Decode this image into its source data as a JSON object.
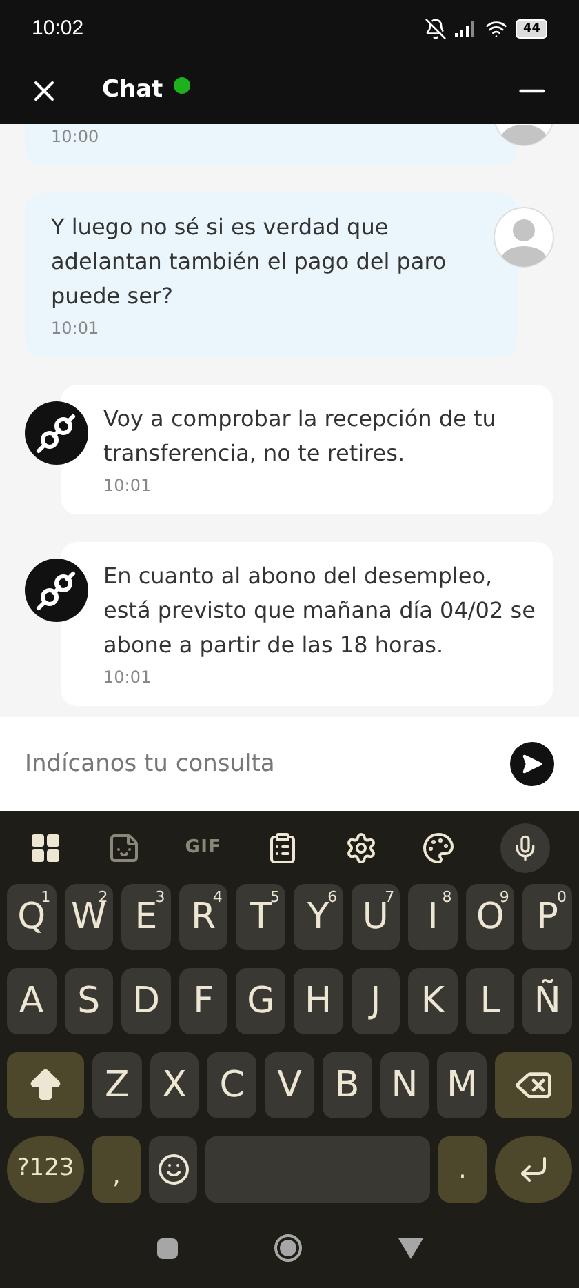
{
  "status_bar": {
    "time": "10:02",
    "battery": "44"
  },
  "header": {
    "title": "Chat",
    "online": true
  },
  "messages": [
    {
      "kind": "user",
      "time": "10:00"
    },
    {
      "kind": "user",
      "text": "Y luego no sé si es verdad que adelantan también el pago del paro puede ser?",
      "time": "10:01"
    },
    {
      "kind": "agent",
      "text": "Voy a comprobar la recepción de tu transferencia, no te retires.",
      "time": "10:01"
    },
    {
      "kind": "agent",
      "text": "En cuanto al abono del desempleo, está previsto que mañana día 04/02 se abone a partir de las 18 horas.",
      "time": "10:01"
    }
  ],
  "composer": {
    "placeholder": "Indícanos tu consulta"
  },
  "keyboard": {
    "toolbar": [
      {
        "kind": "apps"
      },
      {
        "kind": "sticker"
      },
      {
        "kind": "gif",
        "label": "GIF"
      },
      {
        "kind": "clipboard"
      },
      {
        "kind": "settings"
      },
      {
        "kind": "palette"
      },
      {
        "kind": "mic"
      }
    ],
    "rows": [
      [
        {
          "kind": "letter",
          "label": "Q",
          "hint": "1"
        },
        {
          "kind": "letter",
          "label": "W",
          "hint": "2"
        },
        {
          "kind": "letter",
          "label": "E",
          "hint": "3"
        },
        {
          "kind": "letter",
          "label": "R",
          "hint": "4"
        },
        {
          "kind": "letter",
          "label": "T",
          "hint": "5"
        },
        {
          "kind": "letter",
          "label": "Y",
          "hint": "6"
        },
        {
          "kind": "letter",
          "label": "U",
          "hint": "7"
        },
        {
          "kind": "letter",
          "label": "I",
          "hint": "8"
        },
        {
          "kind": "letter",
          "label": "O",
          "hint": "9"
        },
        {
          "kind": "letter",
          "label": "P",
          "hint": "0"
        }
      ],
      [
        {
          "kind": "letter",
          "label": "A"
        },
        {
          "kind": "letter",
          "label": "S"
        },
        {
          "kind": "letter",
          "label": "D"
        },
        {
          "kind": "letter",
          "label": "F"
        },
        {
          "kind": "letter",
          "label": "G"
        },
        {
          "kind": "letter",
          "label": "H"
        },
        {
          "kind": "letter",
          "label": "J"
        },
        {
          "kind": "letter",
          "label": "K"
        },
        {
          "kind": "letter",
          "label": "L"
        },
        {
          "kind": "letter",
          "label": "Ñ"
        }
      ],
      [
        {
          "kind": "shift"
        },
        {
          "kind": "letter",
          "label": "Z"
        },
        {
          "kind": "letter",
          "label": "X"
        },
        {
          "kind": "letter",
          "label": "C"
        },
        {
          "kind": "letter",
          "label": "V"
        },
        {
          "kind": "letter",
          "label": "B"
        },
        {
          "kind": "letter",
          "label": "N"
        },
        {
          "kind": "letter",
          "label": "M"
        },
        {
          "kind": "backspace"
        }
      ],
      [
        {
          "kind": "symbols",
          "label": "?123"
        },
        {
          "kind": "comma",
          "label": ","
        },
        {
          "kind": "emoji"
        },
        {
          "kind": "space"
        },
        {
          "kind": "period",
          "label": "."
        },
        {
          "kind": "enter"
        }
      ]
    ]
  }
}
